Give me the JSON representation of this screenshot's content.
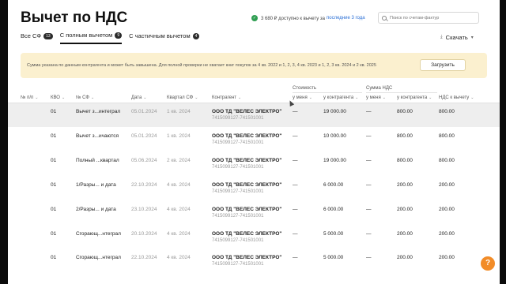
{
  "header": {
    "title": "Вычет по НДС",
    "deduction_text": "3 680 ₽ доступно к вычету за",
    "deduction_link": "последние 3 года",
    "search_placeholder": "Поиск по счетам-фактур"
  },
  "tabs": [
    {
      "label": "Все СФ",
      "count": "13"
    },
    {
      "label": "С полным вычетом",
      "count": "9"
    },
    {
      "label": "С частичным вычетом",
      "count": "4"
    }
  ],
  "download_label": "Скачать",
  "banner": {
    "text": "Сумма указана по данным контрагента и может быть завышена. Для полной проверки не хватает книг покупок за 4 кв. 2022 и 1, 2, 3, 4 кв. 2023 и 1, 2, 3 кв. 2024 и 2 кв. 2025",
    "button": "Загрузить"
  },
  "table": {
    "groups": {
      "cost": "Стоимость",
      "vat": "Сумма НДС"
    },
    "columns": {
      "num": "№ п/п",
      "kvo": "КВО",
      "sf": "№ СФ",
      "date": "Дата",
      "quarter": "Квартал СФ",
      "contractor": "Контрагент",
      "cost_me": "у меня",
      "cost_contr": "у контрагента",
      "vat_me": "у меня",
      "vat_contr": "у контрагента",
      "vat_deduct": "НДС к вычету"
    },
    "rows": [
      {
        "kvo": "01",
        "sf": "Вычет з...интеграл",
        "date": "05.01.2024",
        "quarter": "1 кв. 2024",
        "contractor": "ООО ТД \"ВЕЛЕС ЭЛЕКТРО\"",
        "inn": "7415099127-741501001",
        "cost_me": "—",
        "cost_contr": "19 000.00",
        "vat_me": "—",
        "vat_contr": "800.00",
        "vat_deduct": "800.00"
      },
      {
        "kvo": "01",
        "sf": "Вычет з...ичаются",
        "date": "05.01.2024",
        "quarter": "1 кв. 2024",
        "contractor": "ООО ТД \"ВЕЛЕС ЭЛЕКТРО\"",
        "inn": "7415099127-741501001",
        "cost_me": "—",
        "cost_contr": "10 000.00",
        "vat_me": "—",
        "vat_contr": "800.00",
        "vat_deduct": "800.00"
      },
      {
        "kvo": "01",
        "sf": "Полный ...квартал",
        "date": "05.06.2024",
        "quarter": "2 кв. 2024",
        "contractor": "ООО ТД \"ВЕЛЕС ЭЛЕКТРО\"",
        "inn": "7415099127-741501001",
        "cost_me": "—",
        "cost_contr": "19 000.00",
        "vat_me": "—",
        "vat_contr": "800.00",
        "vat_deduct": "800.00"
      },
      {
        "kvo": "01",
        "sf": "1/Разры... и дата",
        "date": "22.10.2024",
        "quarter": "4 кв. 2024",
        "contractor": "ООО ТД \"ВЕЛЕС ЭЛЕКТРО\"",
        "inn": "7415099127-741501001",
        "cost_me": "—",
        "cost_contr": "6 000.00",
        "vat_me": "—",
        "vat_contr": "200.00",
        "vat_deduct": "200.00"
      },
      {
        "kvo": "01",
        "sf": "2/Разры... и дата",
        "date": "23.10.2024",
        "quarter": "4 кв. 2024",
        "contractor": "ООО ТД \"ВЕЛЕС ЭЛЕКТРО\"",
        "inn": "7415099127-741501001",
        "cost_me": "—",
        "cost_contr": "6 000.00",
        "vat_me": "—",
        "vat_contr": "200.00",
        "vat_deduct": "200.00"
      },
      {
        "kvo": "01",
        "sf": "Сгорающ...нтеграл",
        "date": "20.10.2024",
        "quarter": "4 кв. 2024",
        "contractor": "ООО ТД \"ВЕЛЕС ЭЛЕКТРО\"",
        "inn": "7415099127-741501001",
        "cost_me": "—",
        "cost_contr": "5 000.00",
        "vat_me": "—",
        "vat_contr": "200.00",
        "vat_deduct": "200.00"
      },
      {
        "kvo": "01",
        "sf": "Сгорающ...нтеграл",
        "date": "22.10.2024",
        "quarter": "4 кв. 2024",
        "contractor": "ООО ТД \"ВЕЛЕС ЭЛЕКТРО\"",
        "inn": "7415099127-741501001",
        "cost_me": "—",
        "cost_contr": "5 000.00",
        "vat_me": "—",
        "vat_contr": "200.00",
        "vat_deduct": "200.00"
      }
    ]
  },
  "help_label": "?",
  "colors": {
    "accent_link": "#2a6fd6",
    "banner": "#fbf0cf",
    "help": "#f28c28",
    "success": "#2f9e52"
  }
}
